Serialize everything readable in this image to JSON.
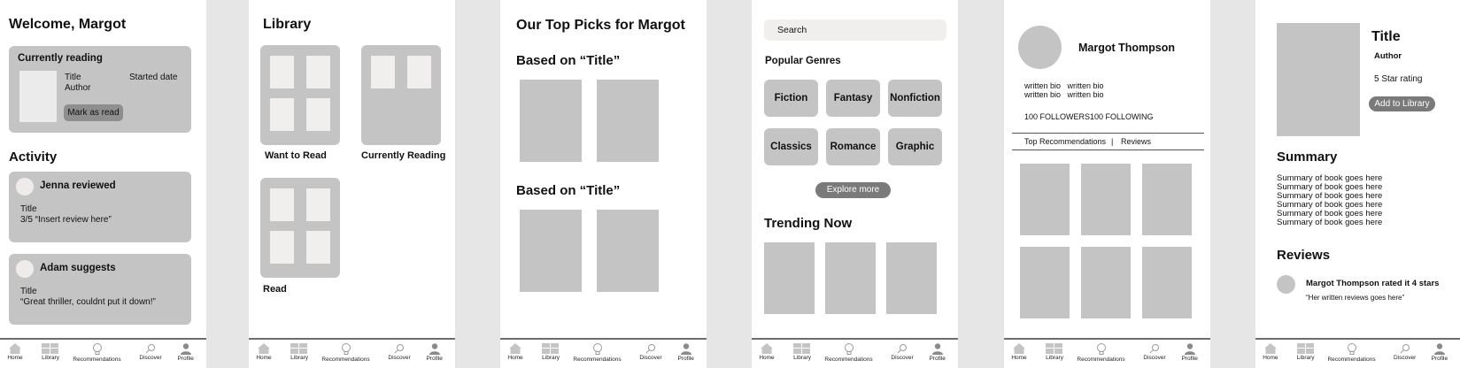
{
  "nav": {
    "home": "Home",
    "library": "Library",
    "recommendations": "Recommendations",
    "discover": "Discover",
    "profile": "Profile"
  },
  "home": {
    "welcome": "Welcome, Margot",
    "currently_reading": {
      "heading": "Currently reading",
      "title": "Title",
      "author": "Author",
      "started": "Started date",
      "button": "Mark as read"
    },
    "activity_heading": "Activity",
    "activity": [
      {
        "who": "Jenna reviewed",
        "line1": "Title",
        "line2": "3/5 “Insert review here”"
      },
      {
        "who": "Adam suggests",
        "line1": "Title",
        "line2": "“Great thriller, couldnt put it down!”"
      }
    ]
  },
  "library": {
    "title": "Library",
    "shelves": [
      "Want to Read",
      "Currently Reading",
      "Read"
    ]
  },
  "recommendations": {
    "title": "Our Top Picks for Margot",
    "section1": "Based on “Title”",
    "section2": "Based on “Title”"
  },
  "discover": {
    "search_placeholder": "Search",
    "popular_genres": "Popular Genres",
    "genres": [
      "Fiction",
      "Fantasy",
      "Nonfiction",
      "Classics",
      "Romance",
      "Graphic"
    ],
    "explore_more": "Explore more",
    "trending_now": "Trending Now"
  },
  "profile": {
    "name": "Margot Thompson",
    "bio1": "written bio   written bio",
    "bio2": "written bio   written bio",
    "followers": "100 FOLLOWERS",
    "following": "100 FOLLOWING",
    "tab_recs": "Top Recommendations",
    "tab_sep": "|",
    "tab_reviews": "Reviews"
  },
  "book": {
    "title": "Title",
    "author": "Author",
    "rating": "5 Star rating",
    "add_button": "Add to Library",
    "summary_heading": "Summary",
    "summary_lines": [
      "Summary of book goes here",
      "Summary of book goes here",
      "Summary of book goes here",
      "Summary of book goes here",
      "Summary of book goes here",
      "Summary of book goes here"
    ],
    "reviews_heading": "Reviews",
    "review_header": "Margot Thompson rated it 4 stars",
    "review_body": "“Her written reviews goes here”"
  }
}
